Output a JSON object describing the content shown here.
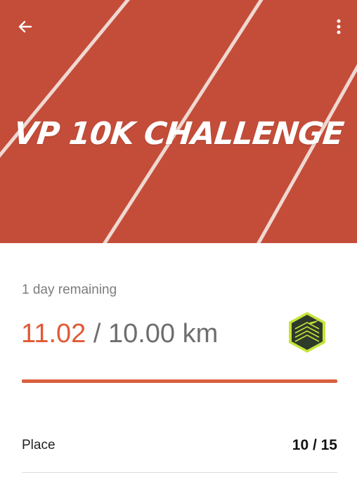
{
  "header": {
    "title": "VP 10K CHALLENGE",
    "back_icon": "arrow-left-icon",
    "more_icon": "more-vertical-icon"
  },
  "challenge": {
    "remaining": "1 day remaining",
    "distance_current": "11.02",
    "distance_separator": " / ",
    "distance_goal": "10.00 km",
    "progress_fraction": 1.0,
    "badge_icon": "nike-challenge-badge-icon"
  },
  "stats": {
    "place_label": "Place",
    "place_value": "10 / 15"
  },
  "colors": {
    "track": "#c8513d",
    "accent": "#e05a35",
    "badge_fill": "#2e3a2a",
    "badge_accent": "#c6e33a"
  }
}
